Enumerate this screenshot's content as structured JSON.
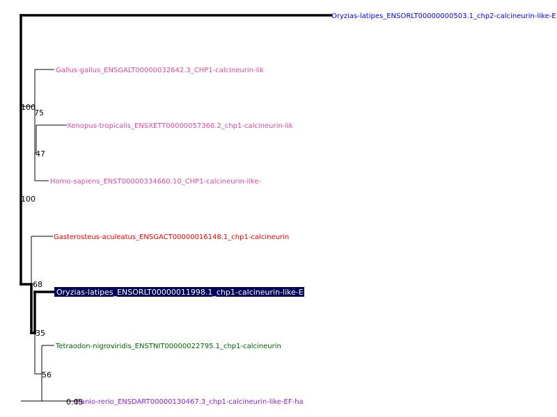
{
  "tree": {
    "colors": {
      "blue": "#0000ff",
      "pink": "#dd4aa0",
      "red": "#ee0000",
      "green": "#006600",
      "purple": "#8a1fd0",
      "selected_bg": "#00005a",
      "selected_text": "#ffffff"
    },
    "leaves": [
      {
        "label": "Oryzias-latipes_ENSORLT00000000503.1_chp2-calcineurin-like-E",
        "color": "blue"
      },
      {
        "label": "Gallus-gallus_ENSGALT00000032642.3_CHP1-calcineurin-lik",
        "color": "pink"
      },
      {
        "label": "Xenopus-tropicalis_ENSXETT00000057366.2_chp1-calcineurin-lik",
        "color": "pink"
      },
      {
        "label": "Homo-sapiens_ENST00000334660.10_CHP1-calcineurin-like-",
        "color": "pink"
      },
      {
        "label": "Gasterosteus-aculeatus_ENSGACT00000016148.1_chp1-calcineurin",
        "color": "red"
      },
      {
        "label": "Oryzias-latipes_ENSORLT00000011998.1_chp1-calcineurin-like-E",
        "color": "selected",
        "selected": true
      },
      {
        "label": "Tetraodon-nigroviridis_ENSTNIT00000022795.1_chp1-calcineurin",
        "color": "green"
      },
      {
        "label": "Danio-rerio_ENSDART00000130467.3_chp1-calcineurin-like-EF-ha",
        "color": "purple"
      }
    ],
    "bootstrap": {
      "root": "100",
      "tetrapods": "100",
      "xenopus_gallus": "75",
      "xenopus_homo": "47",
      "fish": "68",
      "oryzias_tetraodon": "35",
      "tetraodon_danio": "56"
    },
    "scale_label": "0.05"
  }
}
